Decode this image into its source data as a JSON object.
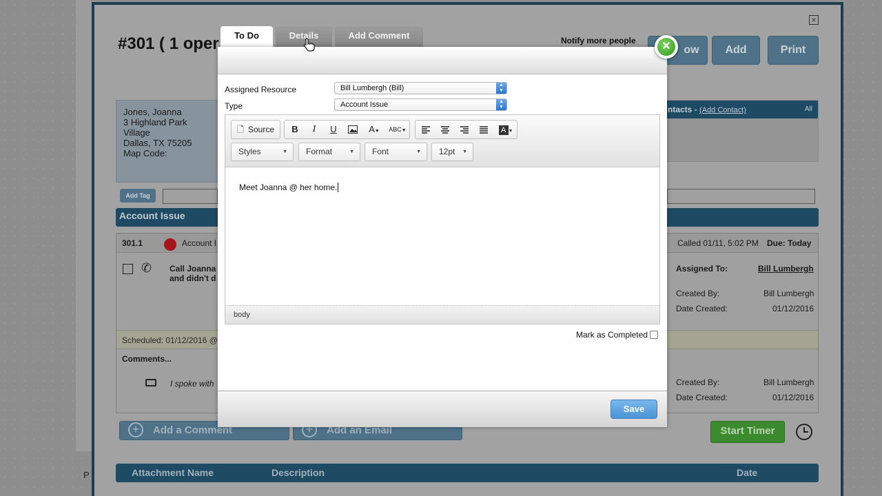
{
  "background": {
    "ticket_title": "#301 ( 1 oper",
    "notify_label": "Notify more people",
    "buttons": {
      "follow": "ow",
      "add": "Add",
      "print": "Print"
    },
    "address": {
      "name": "Jones, Joanna",
      "street": "3 Highland Park Village",
      "city": "Dallas, TX 75205",
      "map_code": "Map Code:"
    },
    "contacts": {
      "label": "ntacts -",
      "add_link": "(Add Contact)",
      "all": "All"
    },
    "add_tag": "Add Tag",
    "section_title": "Account Issue",
    "task": {
      "id": "301.1",
      "category": "Account I",
      "called": "Called  01/11, 5:02 PM",
      "due": "Due: Today",
      "desc_line1": "Call Joanna",
      "desc_line2": "and didn't d",
      "assigned_label": "Assigned To:",
      "assigned_value": "Bill Lumbergh",
      "created_by_label": "Created By:",
      "created_by_value": "Bill Lumbergh",
      "date_created_label": "Date Created:",
      "date_created_value": "01/12/2016",
      "scheduled": "Scheduled:  01/12/2016 @",
      "comments_label": "Comments...",
      "comment_preview": "I spoke with",
      "comment_created_by_label": "Created By:",
      "comment_created_by_value": "Bill Lumbergh",
      "comment_date_label": "Date Created:",
      "comment_date_value": "01/12/2016"
    },
    "add_comment": "Add a Comment",
    "add_email": "Add an Email",
    "start_timer": "Start Timer",
    "attach_cols": [
      "Attachment Name",
      "Description",
      "Date"
    ],
    "stray_char": "P"
  },
  "modal": {
    "tabs": [
      {
        "label": "To Do",
        "active": true
      },
      {
        "label": "Details",
        "active": false
      },
      {
        "label": "Add Comment",
        "active": false
      }
    ],
    "assigned_resource_label": "Assigned Resource",
    "assigned_resource_value": "Bill Lumbergh (Bill)",
    "type_label": "Type",
    "type_value": "Account Issue",
    "toolbar": {
      "source": "Source",
      "bold": "B",
      "italic": "I",
      "underline": "U",
      "image": "image-icon",
      "text_color": "A",
      "spellcheck": "ABC",
      "align": [
        "align-left-icon",
        "align-center-icon",
        "align-right-icon",
        "align-justify-icon"
      ],
      "bg_color": "A",
      "styles": "Styles",
      "format": "Format",
      "font": "Font",
      "size": "12pt"
    },
    "editor_text": "Meet Joanna @ her home.",
    "status_path": "body",
    "mark_completed_label": "Mark as Completed",
    "mark_completed": false,
    "save_label": "Save",
    "accent_color": "#4a93d6",
    "close_color": "#2f9a1c"
  }
}
